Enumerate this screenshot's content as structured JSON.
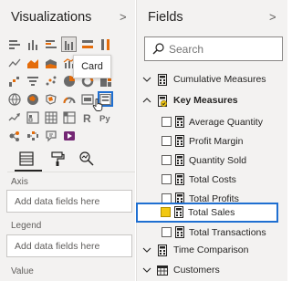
{
  "visualizations": {
    "title": "Visualizations",
    "collapse_glyph": ">",
    "tooltip": "Card",
    "tabs": [
      "fields-tab",
      "format-tab",
      "analytics-tab"
    ],
    "axis_label": "Axis",
    "axis_placeholder": "Add data fields here",
    "legend_label": "Legend",
    "legend_placeholder": "Add data fields here",
    "value_label": "Value",
    "gallery": [
      "stacked-bar-icon",
      "stacked-column-icon",
      "clustered-bar-icon",
      "clustered-column-icon",
      "100pct-bar-icon",
      "100pct-column-icon",
      "line-chart-icon",
      "area-chart-icon",
      "stacked-area-icon",
      "line-column-icon",
      "line-clustered-column-icon",
      "ribbon-chart-icon",
      "waterfall-icon",
      "funnel-icon",
      "scatter-icon",
      "pie-chart-icon",
      "donut-chart-icon",
      "treemap-icon",
      "map-icon",
      "filled-map-icon",
      "shape-map-icon",
      "gauge-icon",
      "card-icon",
      "multirow-card-icon",
      "kpi-icon",
      "slicer-icon",
      "table-icon",
      "matrix-icon",
      "r-visual-icon",
      "python-visual-icon",
      "key-influencers-icon",
      "decomposition-tree-icon",
      "qa-icon",
      "power-apps-icon"
    ],
    "python_glyph": "Py",
    "r_glyph": "R",
    "hovered_icon": "clustered-column-icon",
    "selected_icon": "multirow-card-icon"
  },
  "fields": {
    "title": "Fields",
    "collapse_glyph": ">",
    "search_placeholder": "Search",
    "groups": [
      {
        "name": "Cumulative Measures",
        "expanded": false
      },
      {
        "name": "Key Measures",
        "expanded": true,
        "items": [
          {
            "name": "Average Quantity",
            "checked": false
          },
          {
            "name": "Profit Margin",
            "checked": false
          },
          {
            "name": "Quantity Sold",
            "checked": false
          },
          {
            "name": "Total Costs",
            "checked": false
          },
          {
            "name": "Total Profits",
            "checked": false
          },
          {
            "name": "Total Sales",
            "checked": true
          },
          {
            "name": "Total Transactions",
            "checked": false
          }
        ]
      },
      {
        "name": "Time Comparison",
        "expanded": false
      },
      {
        "name": "Customers",
        "expanded": false
      }
    ]
  },
  "colors": {
    "accent": "#1f6fd1",
    "checked": "#f2c811",
    "pane_bg": "#f3f2f1"
  }
}
